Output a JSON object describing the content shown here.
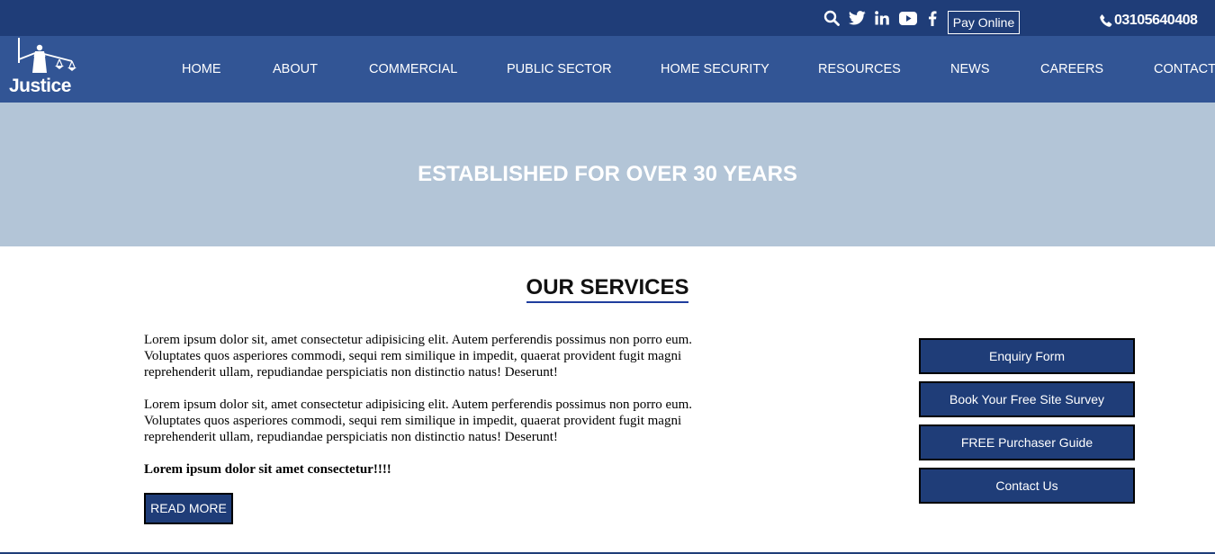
{
  "topbar": {
    "icons": [
      "search-icon",
      "twitter-icon",
      "linkedin-icon",
      "youtube-icon",
      "facebook-icon",
      "phone-icon"
    ],
    "pay_online_label": "Pay Online",
    "phone_number": "03105640408"
  },
  "logo": {
    "text": "Justice"
  },
  "nav": {
    "items": [
      {
        "label": "HOME"
      },
      {
        "label": "ABOUT"
      },
      {
        "label": "COMMERCIAL"
      },
      {
        "label": "PUBLIC SECTOR"
      },
      {
        "label": "HOME SECURITY"
      },
      {
        "label": "RESOURCES"
      },
      {
        "label": "NEWS"
      },
      {
        "label": "CAREERS"
      },
      {
        "label": "CONTACT"
      }
    ]
  },
  "hero": {
    "title": "ESTABLISHED FOR OVER 30 YEARS"
  },
  "services": {
    "title": "OUR SERVICES",
    "paragraphs": [
      "Lorem ipsum dolor sit, amet consectetur adipisicing elit. Autem perferendis possimus non porro eum. Voluptates quos asperiores commodi, sequi rem similique in impedit, quaerat provident fugit magni reprehenderit ullam, repudiandae perspiciatis non distinctio natus! Deserunt!",
      "Lorem ipsum dolor sit, amet consectetur adipisicing elit. Autem perferendis possimus non porro eum. Voluptates quos asperiores commodi, sequi rem similique in impedit, quaerat provident fugit magni reprehenderit ullam, repudiandae perspiciatis non distinctio natus! Deserunt!",
      "Lorem ipsum dolor sit amet consectetur!!!!"
    ],
    "read_more_label": "READ MORE",
    "side_buttons": [
      {
        "label": "Enquiry Form"
      },
      {
        "label": "Book Your Free Site Survey"
      },
      {
        "label": "FREE Purchaser Guide"
      },
      {
        "label": "Contact Us"
      }
    ]
  },
  "colors": {
    "topbar_bg": "#1f3d78",
    "navbar_bg": "#325595",
    "hero_bg": "#b3c5d7",
    "button_bg": "#1f3d78",
    "title_underline": "#1f3d9e"
  }
}
